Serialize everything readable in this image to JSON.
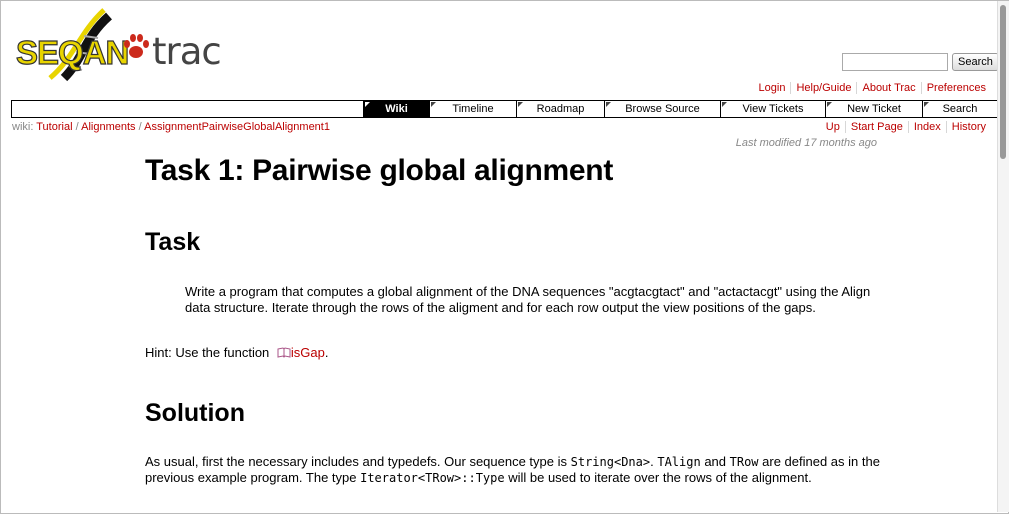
{
  "header": {
    "logo_seqan": "SEQAN",
    "logo_trac": "trac",
    "search_button": "Search"
  },
  "metanav": [
    "Login",
    "Help/Guide",
    "About Trac",
    "Preferences"
  ],
  "mainnav": {
    "active": "Wiki",
    "tabs": [
      "Wiki",
      "Timeline",
      "Roadmap",
      "Browse Source",
      "View Tickets",
      "New Ticket",
      "Search"
    ]
  },
  "pagepath": {
    "prefix": "wiki:",
    "crumbs": [
      "Tutorial",
      "Alignments",
      "AssignmentPairwiseGlobalAlignment1"
    ],
    "sep": "/"
  },
  "ctxtnav": [
    "Up",
    "Start Page",
    "Index",
    "History"
  ],
  "last_modified": "Last modified 17 months ago",
  "content": {
    "title": "Task 1: Pairwise global alignment",
    "task_heading": "Task",
    "task_text": "Write a program that computes a global alignment of the DNA sequences \"acgtacgtact\" and \"actactacgt\" using the Align data structure. Iterate through the rows of the aligment and for each row output the view positions of the gaps.",
    "hint_prefix": "Hint: Use the function",
    "hint_link": "isGap",
    "hint_suffix": ".",
    "solution_heading": "Solution",
    "sol_1": "As usual, first the necessary includes and typedefs. Our sequence type is ",
    "sol_code1": "String<Dna>",
    "sol_2": ". ",
    "sol_code2": "TAlign",
    "sol_3": " and ",
    "sol_code3": "TRow",
    "sol_4": " are defined as in the previous example program. The type ",
    "sol_code4": "Iterator<TRow>::Type",
    "sol_5": " will be used to iterate over the rows of the alignment."
  },
  "colors": {
    "link": "#bb0000",
    "logo_yellow": "#e8d400",
    "paw_red": "#cc2a1c"
  }
}
